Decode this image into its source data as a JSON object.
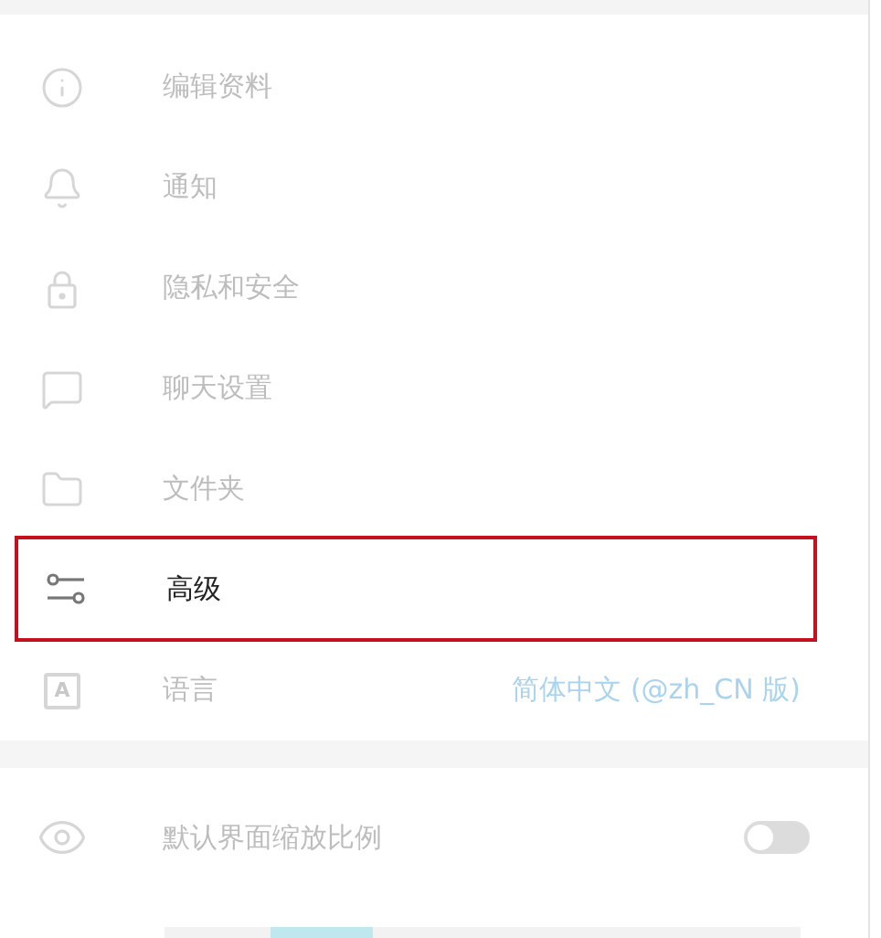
{
  "menu": [
    {
      "kind": "info",
      "label": "编辑资料",
      "highlighted": false
    },
    {
      "kind": "bell",
      "label": "通知",
      "highlighted": false
    },
    {
      "kind": "lock",
      "label": "隐私和安全",
      "highlighted": false
    },
    {
      "kind": "chat",
      "label": "聊天设置",
      "highlighted": false
    },
    {
      "kind": "folder",
      "label": "文件夹",
      "highlighted": false
    },
    {
      "kind": "sliders",
      "label": "高级",
      "highlighted": true
    },
    {
      "kind": "language",
      "label": "语言",
      "highlighted": false,
      "icon_letter": "A",
      "value": "简体中文 (@zh_CN 版)"
    }
  ],
  "scale": {
    "label": "默认界面缩放比例",
    "on": false
  }
}
